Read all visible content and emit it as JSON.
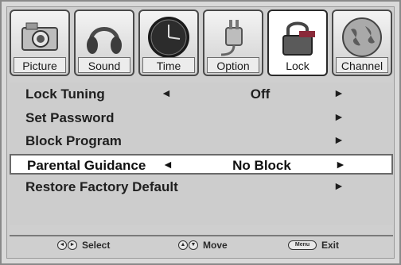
{
  "tabs": [
    {
      "label": "Picture",
      "icon": "camera-icon"
    },
    {
      "label": "Sound",
      "icon": "headphones-icon"
    },
    {
      "label": "Time",
      "icon": "clock-icon"
    },
    {
      "label": "Option",
      "icon": "plug-icon"
    },
    {
      "label": "Lock",
      "icon": "padlock-icon"
    },
    {
      "label": "Channel",
      "icon": "globe-icon"
    }
  ],
  "active_tab": "Lock",
  "menu": {
    "rows": [
      {
        "name": "Lock Tuning",
        "value": "Off",
        "left_arrow": "◄",
        "right_arrow": "►"
      },
      {
        "name": "Set Password",
        "value": "",
        "left_arrow": "",
        "right_arrow": "►"
      },
      {
        "name": "Block Program",
        "value": "",
        "left_arrow": "",
        "right_arrow": "►"
      },
      {
        "name": "Parental Guidance",
        "value": "No Block",
        "left_arrow": "◄",
        "right_arrow": "►"
      },
      {
        "name": "Restore Factory Default",
        "value": "",
        "left_arrow": "",
        "right_arrow": "►"
      }
    ],
    "selected_index": 3
  },
  "footer": {
    "select_label": "Select",
    "move_label": "Move",
    "exit_label": "Exit",
    "menu_key_label": "Menu"
  }
}
